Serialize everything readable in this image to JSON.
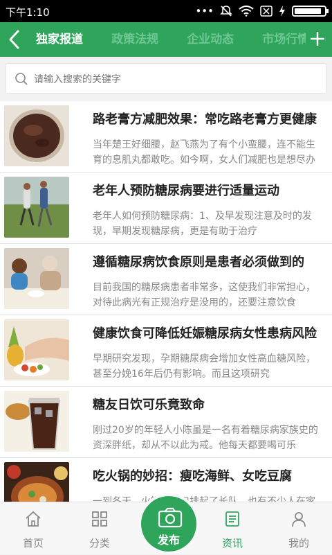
{
  "status": {
    "time": "下午1:10",
    "icons": [
      "dots-icon",
      "mute-bell-icon",
      "wifi-icon",
      "sim-x-icon",
      "charging-icon",
      "battery-icon"
    ],
    "battery_level": 0.9
  },
  "header": {
    "tabs": [
      {
        "label": "独家报道",
        "active": true
      },
      {
        "label": "政策法规",
        "active": false
      },
      {
        "label": "企业动态",
        "active": false
      },
      {
        "label": "市场行情",
        "active": false
      }
    ]
  },
  "search": {
    "placeholder": "请输入搜索的关键字"
  },
  "articles": [
    {
      "title": "路老膏方减肥效果：常吃路老膏方更健康",
      "summary": "当年楚王好细腰，赵飞燕为了有个小蛮腰，连不能生育的息肌丸都敢吃。如今啊，女人们减肥也是想尽办法",
      "thumb": "jar"
    },
    {
      "title": "老年人预防糖尿病要进行适量运动",
      "summary": "老年人如何预防糖尿病：1、及早发现注意及时的发现，早期发现糖尿病，更是有助于治疗",
      "thumb": "runners"
    },
    {
      "title": "遵循糖尿病饮食原则是患者必须做到的",
      "summary": "目前我国的糖尿病患者非常多，这使我们非常担心，对待此病光有正规治疗是没用的，还要注意饮食",
      "thumb": "couple"
    },
    {
      "title": "健康饮食可降低妊娠糖尿病女性患病风险",
      "summary": "早期研究发现，孕期糖尿病会增加女性高血糖风险，甚至分娩16年后仍有影响。而且这项研究",
      "thumb": "fruit"
    },
    {
      "title": "糖友日饮可乐竟致命",
      "summary": "刚过20岁的年轻人小陈虽是一名有着糖尿病家族史的资深胖纸，却从不以此为戒。他每天都要喝可乐",
      "thumb": "cola"
    },
    {
      "title": "吃火锅的妙招：瘦吃海鲜、女吃豆腐",
      "summary": "一到冬天，火锅店门口排起了长队，也有不少人在家里吃火锅",
      "thumb": "hotpot"
    }
  ],
  "nav": {
    "home": "首页",
    "category": "分类",
    "publish": "发布",
    "news": "资讯",
    "mine": "我的",
    "active": "news"
  },
  "colors": {
    "brand": "#2fa55c",
    "tab_inactive": "#6fc793"
  }
}
